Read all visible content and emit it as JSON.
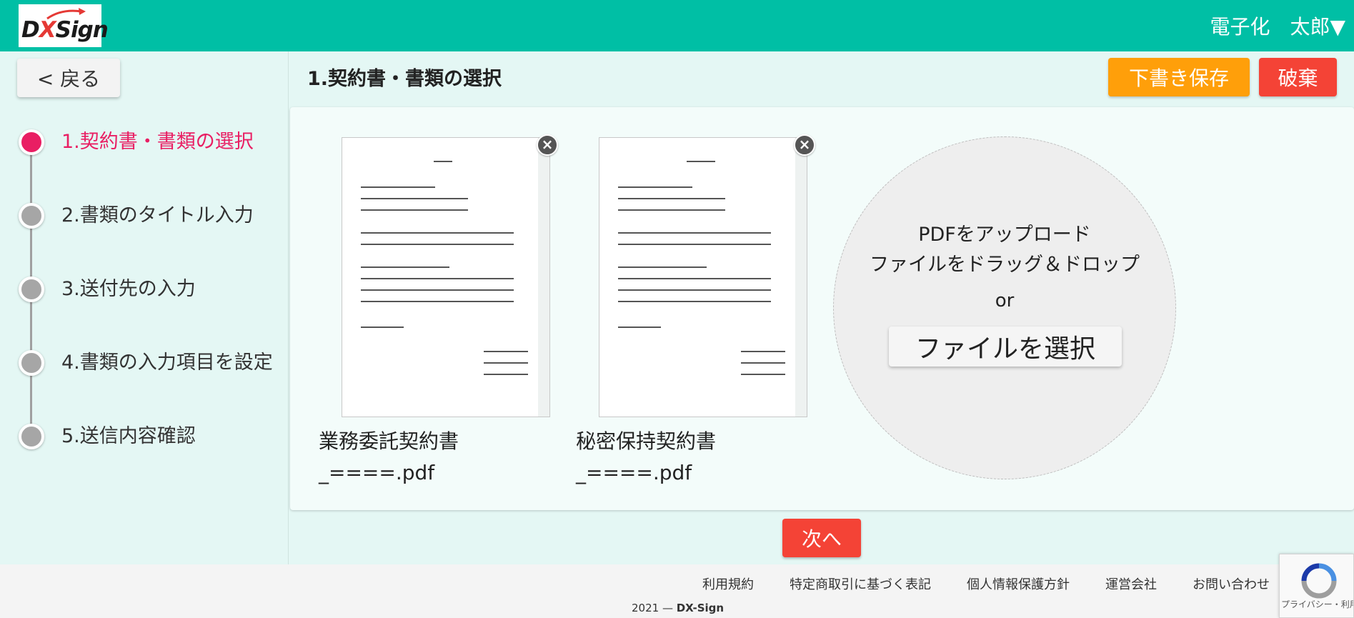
{
  "header": {
    "logo_text_d": "D",
    "logo_text_x": "X",
    "logo_text_sign": "Sign",
    "user_label": "電子化　太郎▼",
    "bg_color": "#00bfa5"
  },
  "sidebar": {
    "back_label": "< 戻る",
    "steps": [
      {
        "label": "1.契約書・書類の選択",
        "active": true
      },
      {
        "label": "2.書類のタイトル入力",
        "active": false
      },
      {
        "label": "3.送付先の入力",
        "active": false
      },
      {
        "label": "4.書類の入力項目を設定",
        "active": false
      },
      {
        "label": "5.送信内容確認",
        "active": false
      }
    ]
  },
  "main": {
    "title": "1.契約書・書類の選択",
    "draft_label": "下書き保存",
    "discard_label": "破棄",
    "documents": [
      {
        "name": "業務委託契約書\n_====.pdf",
        "remove_icon": "×"
      },
      {
        "name": "秘密保持契約書\n_====.pdf",
        "remove_icon": "×"
      }
    ],
    "upload": {
      "line1": "PDFをアップロード",
      "line2": "ファイルをドラッグ＆ドロップ",
      "or": "or",
      "choose_label": "ファイルを選択"
    },
    "next_label": "次へ"
  },
  "footer": {
    "links": [
      "利用規約",
      "特定商取引に基づく表記",
      "個人情報保護方針",
      "運営会社",
      "お問い合わせ"
    ],
    "copyright_prefix": "2021 — ",
    "copyright_brand": "DX-Sign"
  },
  "recaptcha": {
    "text": "プライバシー・利用規約"
  },
  "colors": {
    "accent": "#00bfa5",
    "active_step": "#e91e63",
    "draft": "#ff9f0a",
    "danger": "#f44336"
  }
}
